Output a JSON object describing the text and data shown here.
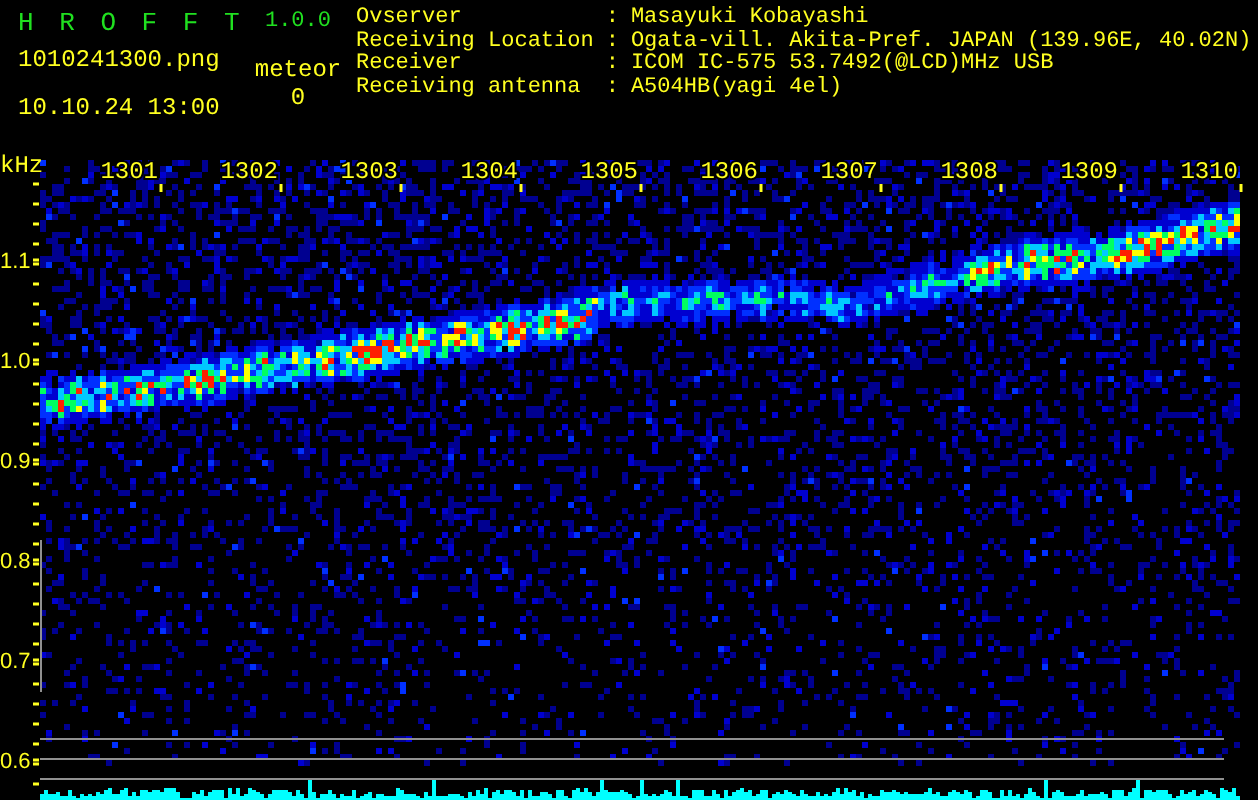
{
  "app": {
    "name": "H R O F F T",
    "version": "1.0.0"
  },
  "file": {
    "filename": "1010241300.png",
    "datetime": "10.10.24 13:00"
  },
  "meteor": {
    "label": "meteor",
    "count": "0"
  },
  "station_info": [
    {
      "label": "Ovserver",
      "separator": ":",
      "value": "Masayuki Kobayashi"
    },
    {
      "label": "Receiving Location",
      "separator": ":",
      "value": "Ogata-vill. Akita-Pref. JAPAN (139.96E, 40.02N)"
    },
    {
      "label": "Receiver",
      "separator": ":",
      "value": "ICOM IC-575 53.7492(@LCD)MHz USB"
    },
    {
      "label": "Receiving antenna",
      "separator": ":",
      "value": "A504HB(yagi 4el)"
    }
  ],
  "spectrogram": {
    "y_unit": "kHz",
    "y_labels": [
      "1.1",
      "1.0",
      "0.9",
      "0.8",
      "0.7",
      "0.6"
    ],
    "time_labels": [
      "1301",
      "1302",
      "1303",
      "1304",
      "1305",
      "1306",
      "1307",
      "1308",
      "1309",
      "1310"
    ]
  }
}
